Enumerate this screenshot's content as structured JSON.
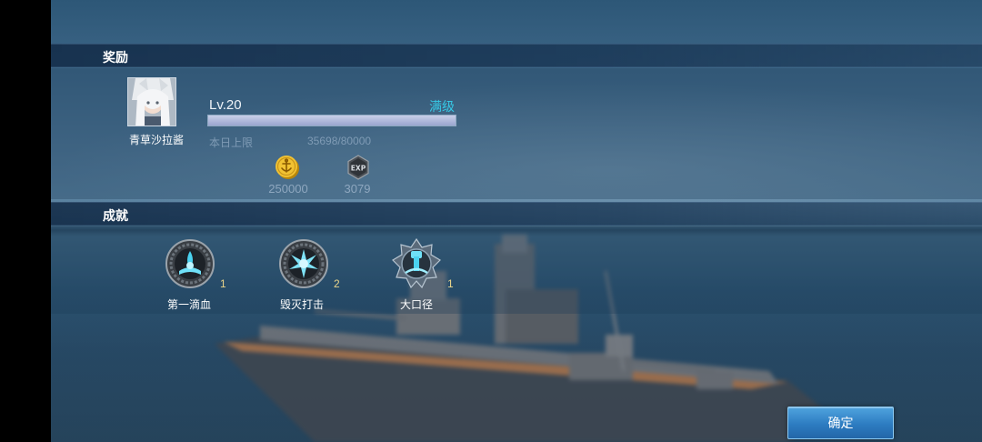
{
  "rewards_section": {
    "title": "奖励",
    "player": {
      "name": "青草沙拉酱",
      "level": "Lv.20",
      "max_level_label": "满级",
      "exp_progress": 1.0
    },
    "daily_cap": {
      "label": "本日上限",
      "value": "35698/80000"
    },
    "items": [
      {
        "icon": "gold-coin-icon",
        "value": "250000"
      },
      {
        "icon": "exp-badge-icon",
        "icon_text": "EXP",
        "value": "3079"
      }
    ]
  },
  "achievements_section": {
    "title": "成就",
    "items": [
      {
        "name": "第一滴血",
        "count": "1",
        "icon": "first-blood-medal-icon"
      },
      {
        "name": "毁灭打击",
        "count": "2",
        "icon": "devastating-strike-medal-icon"
      },
      {
        "name": "大口径",
        "count": "1",
        "icon": "big-caliber-medal-icon"
      }
    ]
  },
  "confirm_label": "确定",
  "colors": {
    "accent_cyan": "#36c9e6",
    "button_blue": "#2d7cc1",
    "header_bar": "#16324f",
    "gold": "#e6b52a"
  }
}
